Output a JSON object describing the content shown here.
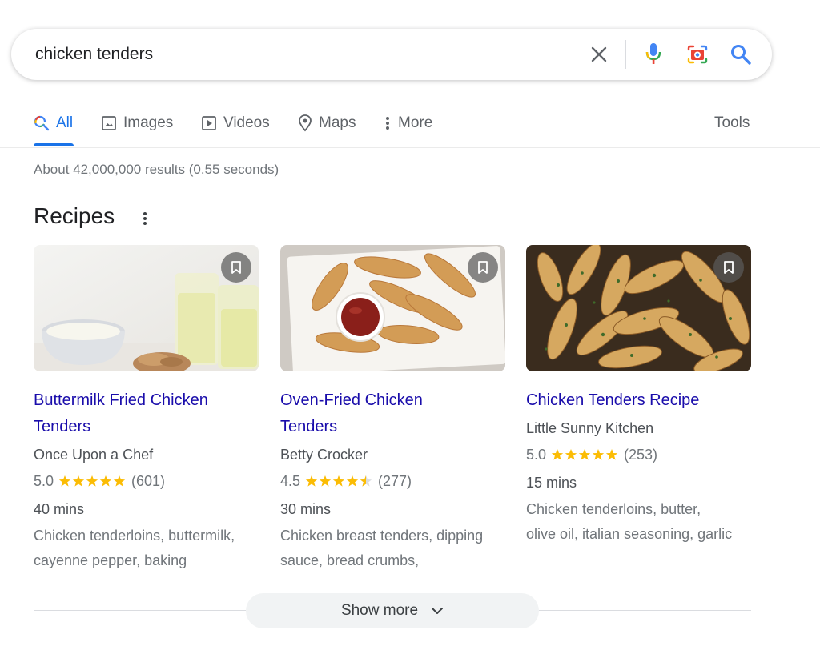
{
  "search": {
    "query": "chicken tenders"
  },
  "tabs": [
    {
      "label": "All",
      "icon": "search-icon",
      "active": true
    },
    {
      "label": "Images",
      "icon": "image-icon"
    },
    {
      "label": "Videos",
      "icon": "video-icon"
    },
    {
      "label": "Maps",
      "icon": "map-pin-icon"
    },
    {
      "label": "More",
      "icon": "more-vertical-icon"
    },
    {
      "label": "Tools"
    }
  ],
  "result_stats": "About 42,000,000 results (0.55 seconds)",
  "recipes": {
    "heading": "Recipes",
    "cards": [
      {
        "title_line1": "Buttermilk Fried Chicken",
        "title_line2": "Tenders",
        "source": "Once Upon a Chef",
        "rating": "5.0",
        "stars": 5,
        "reviews": "(601)",
        "time": "40 mins",
        "ingredients_line1": "Chicken tenderloins, buttermilk,",
        "ingredients_line2": "cayenne pepper, baking"
      },
      {
        "title_line1": "Oven-Fried Chicken",
        "title_line2": "Tenders",
        "source": "Betty Crocker",
        "rating": "4.5",
        "stars": 4.5,
        "reviews": "(277)",
        "time": "30 mins",
        "ingredients_line1": "Chicken breast tenders, dipping",
        "ingredients_line2": "sauce, bread crumbs,"
      },
      {
        "title_line1": "Chicken Tenders Recipe",
        "title_line2": "",
        "source": "Little Sunny Kitchen",
        "rating": "5.0",
        "stars": 5,
        "reviews": "(253)",
        "time": "15 mins",
        "ingredients_line1": "Chicken tenderloins, butter,",
        "ingredients_line2": "olive oil, italian seasoning, garlic"
      }
    ]
  },
  "show_more": {
    "label": "Show more"
  },
  "colors": {
    "accent": "#1a73e8",
    "link": "#1a0dab",
    "star": "#fbbc04",
    "meta": "#70757a"
  }
}
